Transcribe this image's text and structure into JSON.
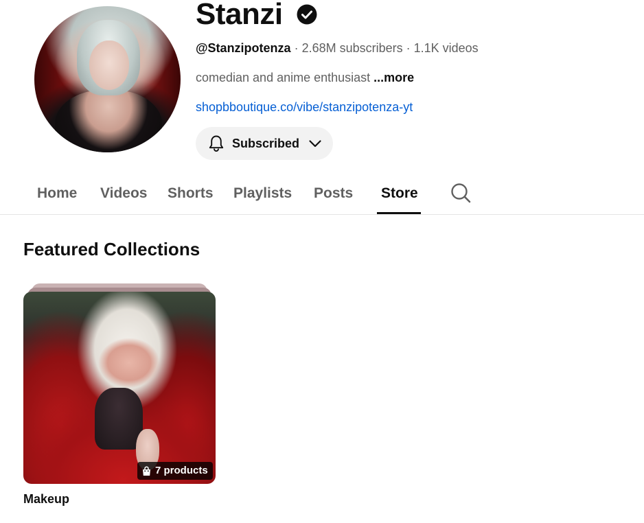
{
  "channel": {
    "name": "Stanzi",
    "handle": "@Stanzipotenza",
    "meta_separator_1": " · ",
    "subscribers": "2.68M subscribers",
    "meta_separator_2": " · ",
    "videos": "1.1K videos",
    "description": "comedian and anime enthusiast ",
    "more_label": "...more",
    "link": "shopbboutique.co/vibe/stanzipotenza-yt",
    "subscribe_label": "Subscribed",
    "verified_icon": "verified-check-icon"
  },
  "tabs": [
    {
      "label": "Home"
    },
    {
      "label": "Videos"
    },
    {
      "label": "Shorts"
    },
    {
      "label": "Playlists"
    },
    {
      "label": "Posts"
    },
    {
      "label": "Store",
      "active": true
    }
  ],
  "section": {
    "title": "Featured Collections"
  },
  "collections": [
    {
      "title": "Makeup",
      "products": "7 products"
    }
  ],
  "colors": {
    "text_primary": "#0f0f0f",
    "text_secondary": "#606060",
    "link": "#065fd4",
    "button_bg": "#f2f2f2"
  }
}
